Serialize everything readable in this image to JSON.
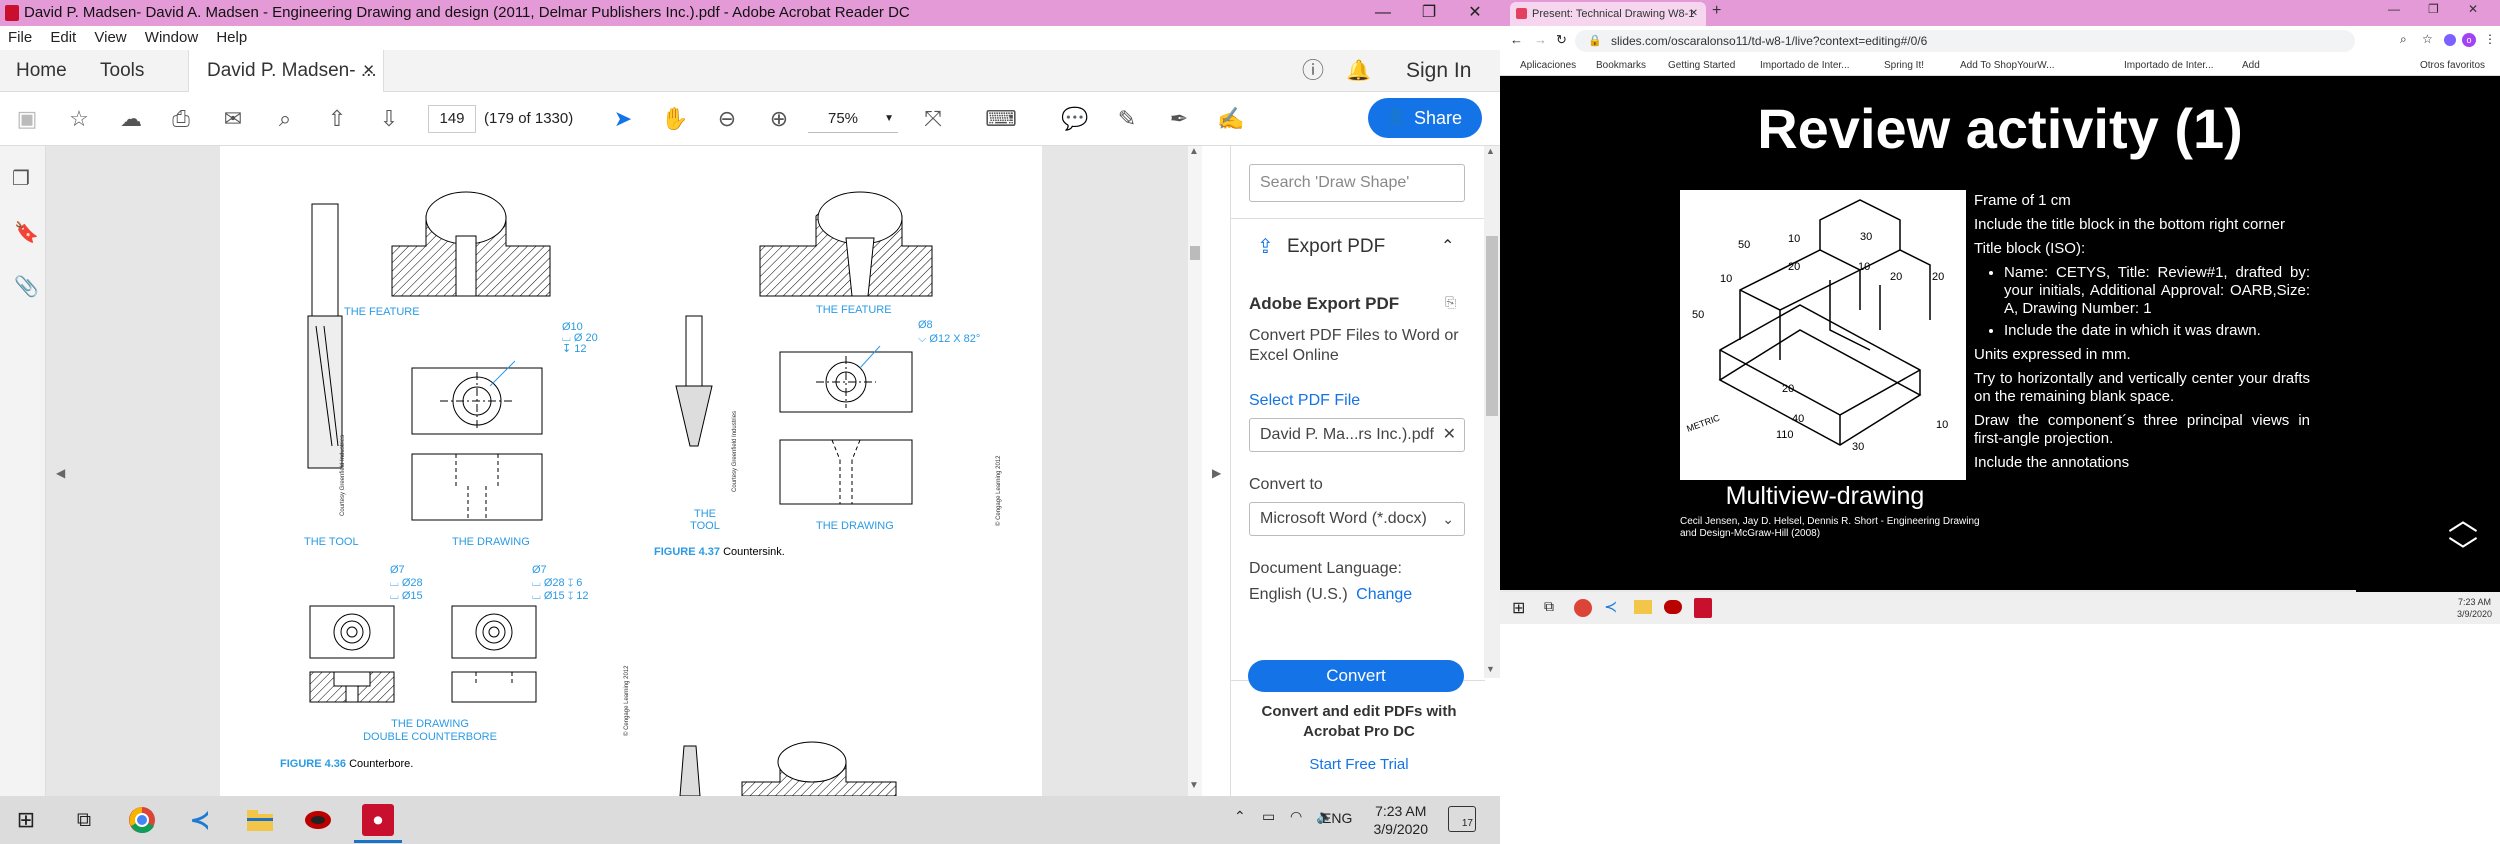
{
  "acrobat": {
    "title": "David P. Madsen- David A. Madsen - Engineering Drawing and design (2011, Delmar Publishers Inc.).pdf - Adobe Acrobat Reader DC",
    "menu": [
      "File",
      "Edit",
      "View",
      "Window",
      "Help"
    ],
    "tabs": {
      "home": "Home",
      "tools": "Tools",
      "doc": "David P. Madsen- ...",
      "sign_in": "Sign In"
    },
    "page_number": "149",
    "page_total": "(179 of 1330)",
    "zoom": "75%",
    "share": "Share",
    "right_panel": {
      "search_placeholder": "Search 'Draw Shape'",
      "export_header": "Export PDF",
      "export_title": "Adobe Export PDF",
      "export_desc": "Convert PDF Files to Word or Excel Online",
      "select_pdf": "Select PDF File",
      "file_name": "David P. Ma...rs Inc.).pdf",
      "convert_to": "Convert to",
      "format": "Microsoft Word (*.docx)",
      "doc_language_label": "Document Language:",
      "doc_language": "English (U.S.)",
      "change": "Change",
      "convert": "Convert",
      "promo": "Convert and edit PDFs with Acrobat Pro DC",
      "trial": "Start Free Trial"
    },
    "page": {
      "feature_left": "THE  FEATURE",
      "feature_right": "THE FEATURE",
      "tool_left": "THE  TOOL",
      "drawing_left": "THE  DRAWING",
      "tool_right": "THE\nTOOL",
      "drawing_right": "THE DRAWING",
      "dim_cb": [
        "Ø10",
        "⌴ Ø 20",
        "↧ 12"
      ],
      "dim_cs": [
        "Ø8",
        "⌵ Ø12 X 82°"
      ],
      "dim_dc1": [
        "Ø7",
        "⌴ Ø28",
        "⌴ Ø15"
      ],
      "dim_dc2": [
        "Ø7",
        "⌴ Ø28 ↧ 6",
        "⌴ Ø15 ↧ 12"
      ],
      "dc_caption1": "THE DRAWING",
      "dc_caption2": "DOUBLE COUNTERBORE",
      "fig437_num": "FIGURE 4.37",
      "fig437_text": "Countersink.",
      "fig436_num": "FIGURE 4.36",
      "fig436_text": "Counterbore.",
      "courtesy1": "Courtesy Greenfield Industries",
      "courtesy2": "Courtesy Greenfield Industries",
      "cengage1": "© Cengage Learning 2012",
      "cengage2": "© Cengage Learning 2012"
    }
  },
  "taskbar": {
    "lang": "ENG",
    "time": "7:23 AM",
    "date": "3/9/2020",
    "notif": "17"
  },
  "chrome": {
    "tab_title": "Present: Technical Drawing W8-1",
    "url": "slides.com/oscaralonso11/td-w8-1/live?context=editing#/0/6",
    "bookmarks": [
      "Aplicaciones",
      "Bookmarks",
      "Getting Started",
      "Importado de Inter...",
      "Spring It!",
      "Add To ShopYourW...",
      "Importado de Inter...",
      "Add",
      "Otros favoritos"
    ],
    "slide": {
      "title": "Review activity (1)",
      "caption": "Multiview-drawing",
      "credit": "Cecil Jensen, Jay D. Helsel, Dennis R. Short - Engineering Drawing and Design-McGraw-Hill (2008)",
      "p1": "Frame of 1 cm",
      "p2": "Include the title block in the bottom right corner",
      "p3": "Title block (ISO):",
      "li1": "Name: CETYS, Title: Review#1, drafted by: your initials, Additional Approval: OARB,Size: A, Drawing Number: 1",
      "li2": "Include the date in which it was drawn.",
      "p4": "Units expressed in mm.",
      "p5": "Try to horizontally and vertically center your drafts on the remaining blank space.",
      "p6": "Draw the component´s three principal views in first-angle projection.",
      "p7": "Include the annotations"
    },
    "dims": [
      "50",
      "10",
      "20",
      "30",
      "10",
      "20",
      "20",
      "10",
      "50",
      "20",
      "40",
      "110",
      "30",
      "10",
      "METRIC"
    ],
    "time": "7:23 AM",
    "date": "3/9/2020"
  }
}
